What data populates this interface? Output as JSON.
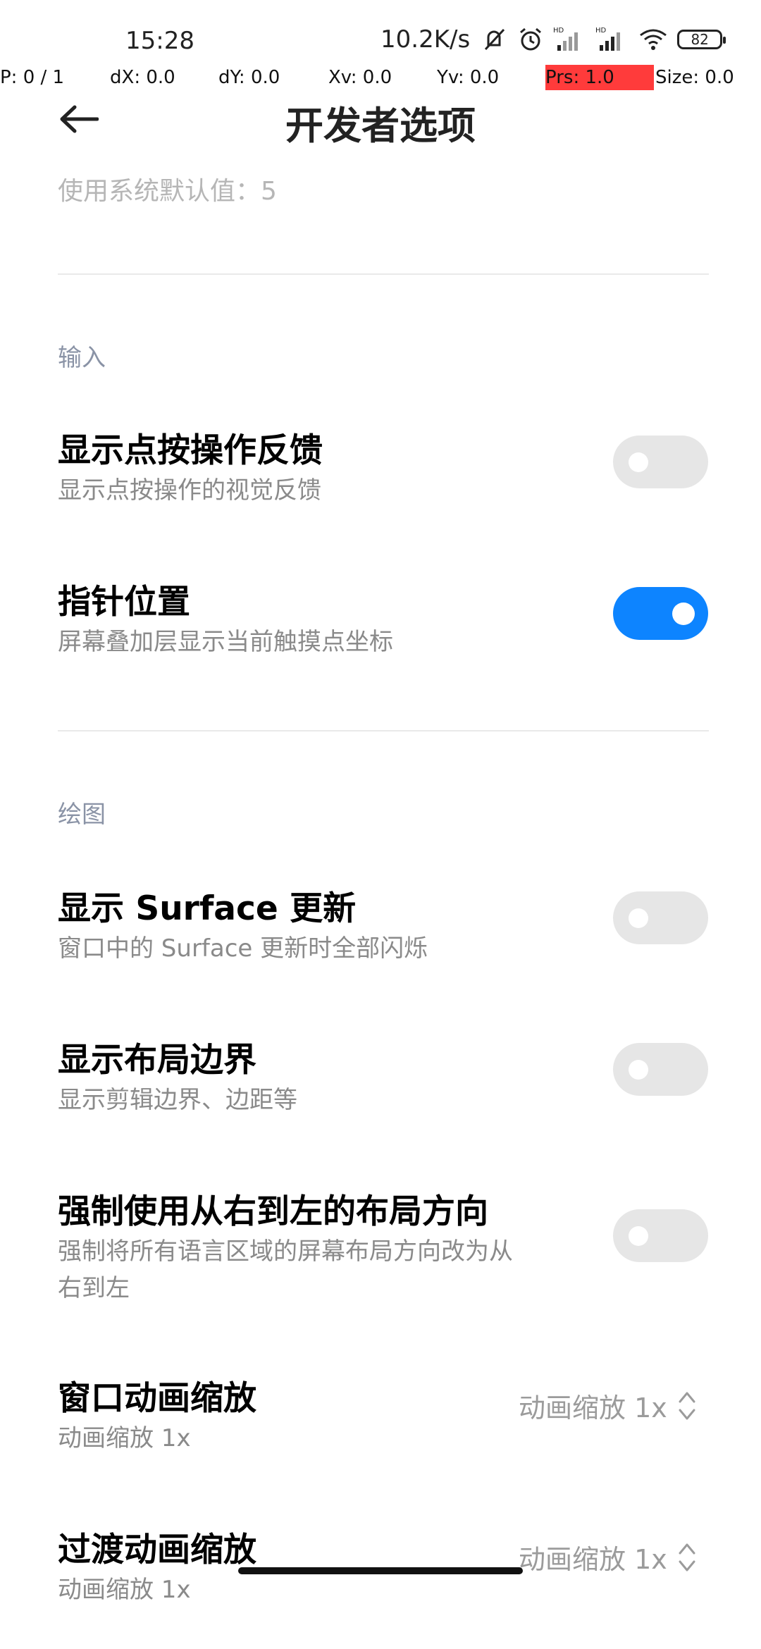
{
  "status_bar": {
    "time": "15:28",
    "net_speed": "10.2K/s",
    "battery": "82"
  },
  "pointer_overlay": {
    "p": "P: 0 / 1",
    "dx": "dX: 0.0",
    "dy": "dY: 0.0",
    "xv": "Xv: 0.0",
    "yv": "Yv: 0.0",
    "prs": "Prs: 1.0",
    "size": "Size: 0.0"
  },
  "header": {
    "title": "开发者选项"
  },
  "faded_text": "使用系统默认值：5",
  "sections": {
    "input": "输入",
    "drawing": "绘图"
  },
  "items": {
    "show_taps": {
      "title": "显示点按操作反馈",
      "subtitle": "显示点按操作的视觉反馈",
      "enabled": false
    },
    "pointer_location": {
      "title": "指针位置",
      "subtitle": "屏幕叠加层显示当前触摸点坐标",
      "enabled": true
    },
    "surface_updates": {
      "title": "显示 Surface 更新",
      "subtitle": "窗口中的 Surface 更新时全部闪烁",
      "enabled": false
    },
    "layout_bounds": {
      "title": "显示布局边界",
      "subtitle": "显示剪辑边界、边距等",
      "enabled": false
    },
    "rtl": {
      "title": "强制使用从右到左的布局方向",
      "subtitle_line1": "强制将所有语言区域的屏幕布局方向改为从",
      "subtitle_line2": "右到左",
      "enabled": false
    },
    "window_anim": {
      "title": "窗口动画缩放",
      "subtitle": "动画缩放 1x",
      "value": "动画缩放 1x"
    },
    "transition_anim": {
      "title": "过渡动画缩放",
      "subtitle": "动画缩放 1x",
      "value": "动画缩放 1x"
    }
  },
  "colors": {
    "accent": "#0d84ff",
    "toggle_off": "#e6e6e6",
    "prs_highlight": "#ff3b3b"
  },
  "icons": [
    "back-arrow-icon",
    "mute-icon",
    "alarm-icon",
    "signal-icon",
    "wifi-icon",
    "battery-icon",
    "updown-icon"
  ]
}
